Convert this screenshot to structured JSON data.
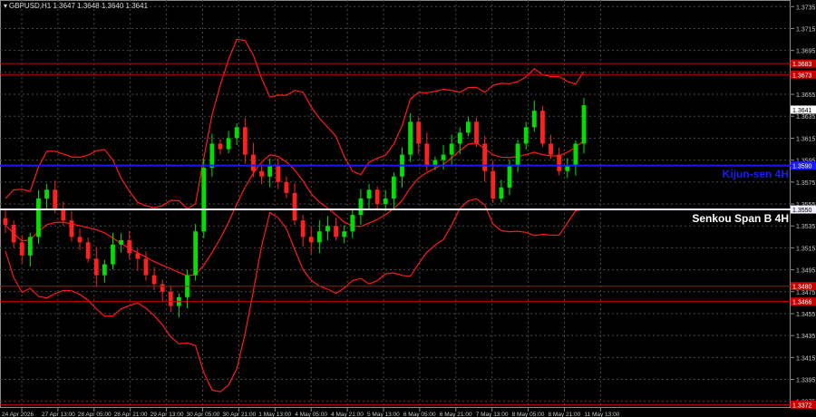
{
  "header": {
    "symbol_line": "GBPUSD,H1  1.3647 1.3648 1.3640 1.3641"
  },
  "labels": {
    "kijun": "Kijun-sen 4H",
    "senkou": "Senkou Span B 4H"
  },
  "colors": {
    "background": "#000000",
    "grid": "#4a4a4a",
    "axis_text": "#c8c8c8",
    "bull": "#00e000",
    "bear": "#ff2020",
    "bands": "#ff1a1a",
    "kijun": "#1a1aff",
    "senkou": "#f0f0ff",
    "level": "#c80000"
  },
  "chart_data": {
    "type": "line",
    "title": "GBPUSD,H1",
    "y_axis": {
      "ticks": [
        "1.3735",
        "1.3715",
        "1.3695",
        "1.3675",
        "1.3655",
        "1.3635",
        "1.3615",
        "1.3595",
        "1.3575",
        "1.3555",
        "1.3535",
        "1.3515",
        "1.3495",
        "1.3475",
        "1.3455",
        "1.3435",
        "1.3415",
        "1.3395",
        "1.3375"
      ],
      "ylim": [
        1.3369,
        1.3741
      ]
    },
    "x_axis": {
      "ticks": [
        "24 Apr 2026",
        "27 Apr 13:00",
        "28 Apr 05:00",
        "28 Apr 21:00",
        "29 Apr 13:00",
        "30 Apr 05:00",
        "30 Apr 21:00",
        "1 May 13:00",
        "4 May 05:00",
        "4 May 21:00",
        "5 May 13:00",
        "6 May 05:00",
        "6 May 21:00",
        "7 May 13:00",
        "8 May 05:00",
        "8 May 21:00",
        "11 May 13:00"
      ]
    },
    "price_labels": [
      {
        "value": 1.3683,
        "text": "1.3683",
        "color": "#c80000"
      },
      {
        "value": 1.3673,
        "text": "1.3673",
        "color": "#c80000"
      },
      {
        "value": 1.3641,
        "text": "1.3641",
        "color": "#ffffff"
      },
      {
        "value": 1.359,
        "text": "1.3590",
        "color": "#1a1aff"
      },
      {
        "value": 1.355,
        "text": "1.3550",
        "color": "#f0f0ff"
      },
      {
        "value": 1.348,
        "text": "1.3480",
        "color": "#c80000"
      },
      {
        "value": 1.3466,
        "text": "1.3466",
        "color": "#c80000"
      },
      {
        "value": 1.3372,
        "text": "1.3372",
        "color": "#c80000"
      }
    ],
    "horizontal_levels": [
      {
        "name": "resistance-1",
        "value": 1.3683,
        "color": "#c80000"
      },
      {
        "name": "resistance-2",
        "value": 1.3673,
        "color": "#c80000"
      },
      {
        "name": "Kijun-sen 4H",
        "value": 1.359,
        "color": "#1a1aff"
      },
      {
        "name": "Senkou Span B 4H",
        "value": 1.355,
        "color": "#f0f0ff"
      },
      {
        "name": "support-1",
        "value": 1.348,
        "color": "#c80000"
      },
      {
        "name": "support-2",
        "value": 1.3466,
        "color": "#c80000"
      },
      {
        "name": "support-3",
        "value": 1.3372,
        "color": "#c80000"
      }
    ],
    "series": [
      {
        "values": [
          1.3536,
          1.352,
          1.3508,
          1.3525,
          1.356,
          1.3568,
          1.355,
          1.354,
          1.3525,
          1.352,
          1.3505,
          1.349,
          1.35,
          1.3518,
          1.3522,
          1.351,
          1.3505,
          1.349,
          1.3482,
          1.3475,
          1.3462,
          1.347,
          1.349,
          1.353,
          1.3588,
          1.361,
          1.3605,
          1.3615,
          1.3625,
          1.36,
          1.3585,
          1.358,
          1.359,
          1.3575,
          1.3565,
          1.354,
          1.3525,
          1.352,
          1.353,
          1.3535,
          1.3525,
          1.353,
          1.3545,
          1.356,
          1.3568,
          1.3555,
          1.356,
          1.358,
          1.36,
          1.363,
          1.361,
          1.359,
          1.3595,
          1.36,
          1.361,
          1.362,
          1.363,
          1.361,
          1.3585,
          1.356,
          1.357,
          1.359,
          1.361,
          1.3625,
          1.364,
          1.361,
          1.36,
          1.3585,
          1.359,
          1.361,
          1.3645
        ]
      }
    ]
  }
}
